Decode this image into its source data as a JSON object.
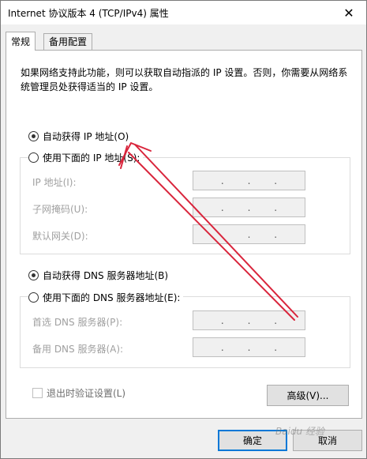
{
  "window": {
    "title": "Internet 协议版本 4 (TCP/IPv4) 属性",
    "close_symbol": "✕"
  },
  "tabs": [
    {
      "label": "常规",
      "active": true
    },
    {
      "label": "备用配置",
      "active": false
    }
  ],
  "description": "如果网络支持此功能，则可以获取自动指派的 IP 设置。否则，你需要从网络系统管理员处获得适当的 IP 设置。",
  "ip_section": {
    "auto_label": "自动获得 IP 地址(O)",
    "auto_selected": true,
    "manual_label": "使用下面的 IP 地址(S):",
    "manual_selected": false,
    "fields": [
      {
        "label": "IP 地址(I):",
        "value": ". . ."
      },
      {
        "label": "子网掩码(U):",
        "value": ". . ."
      },
      {
        "label": "默认网关(D):",
        "value": ". . ."
      }
    ]
  },
  "dns_section": {
    "auto_label": "自动获得 DNS 服务器地址(B)",
    "auto_selected": true,
    "manual_label": "使用下面的 DNS 服务器地址(E):",
    "manual_selected": false,
    "fields": [
      {
        "label": "首选 DNS 服务器(P):",
        "value": ". . ."
      },
      {
        "label": "备用 DNS 服务器(A):",
        "value": ". . ."
      }
    ]
  },
  "validate_on_exit": {
    "label": "退出时验证设置(L)",
    "checked": false
  },
  "buttons": {
    "advanced": "高级(V)...",
    "ok": "确定",
    "cancel": "取消"
  },
  "watermark": "Baidu 经验",
  "annotation_color": "#d9253c"
}
